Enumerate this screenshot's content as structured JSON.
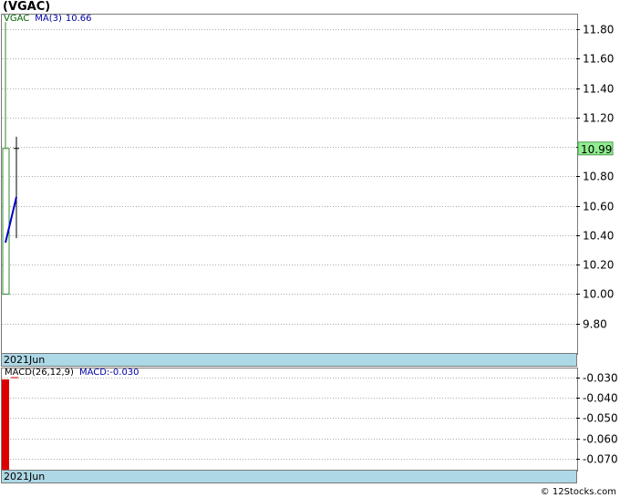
{
  "title": "(VGAC)",
  "price_legend": {
    "symbol": "VGAC",
    "ma_label": "MA(3)",
    "ma_value": "10.66"
  },
  "macd_legend": {
    "label": "MACD(26,12,9)",
    "value_label": "MACD:-0.030"
  },
  "date_label": "2021Jun",
  "price_tag": "10.99",
  "footer": "© 12Stocks.com",
  "colors": {
    "up_candle": "#2e8b2e",
    "ma_line": "#0000cc",
    "macd_bar": "#dd0000",
    "price_tag_bg": "#90ee90",
    "date_strip": "#add8e6",
    "legend_text": "#0000aa",
    "symbol_text": "#006400"
  },
  "chart_data": [
    {
      "type": "candlestick",
      "title": "(VGAC)",
      "ylim": [
        9.6,
        11.9
      ],
      "yticks": [
        9.8,
        10.0,
        10.2,
        10.4,
        10.6,
        10.8,
        11.0,
        11.2,
        11.4,
        11.6,
        11.8
      ],
      "ytick_labels": [
        "9.80",
        "10.00",
        "10.20",
        "10.40",
        "10.60",
        "10.80",
        "11.00",
        "11.20",
        "11.40",
        "11.60",
        "11.80"
      ],
      "grid": true,
      "candles": [
        {
          "open": 10.0,
          "close": 10.99,
          "high": 11.85,
          "low": 10.0
        },
        {
          "open": 10.99,
          "close": 10.99,
          "high": 11.07,
          "low": 10.38
        }
      ],
      "ma_series": {
        "name": "MA(3)",
        "values": [
          10.35,
          10.66
        ]
      },
      "last_price": 10.99,
      "x_label": "2021Jun"
    },
    {
      "type": "bar",
      "title": "MACD(26,12,9)",
      "ylim": [
        -0.0755,
        -0.0255
      ],
      "yticks": [
        -0.03,
        -0.04,
        -0.05,
        -0.06,
        -0.07
      ],
      "ytick_labels": [
        "-0.030",
        "-0.040",
        "-0.050",
        "-0.060",
        "-0.070"
      ],
      "grid": true,
      "values": [
        -0.03
      ],
      "macd_value": -0.03,
      "x_label": "2021Jun"
    }
  ]
}
